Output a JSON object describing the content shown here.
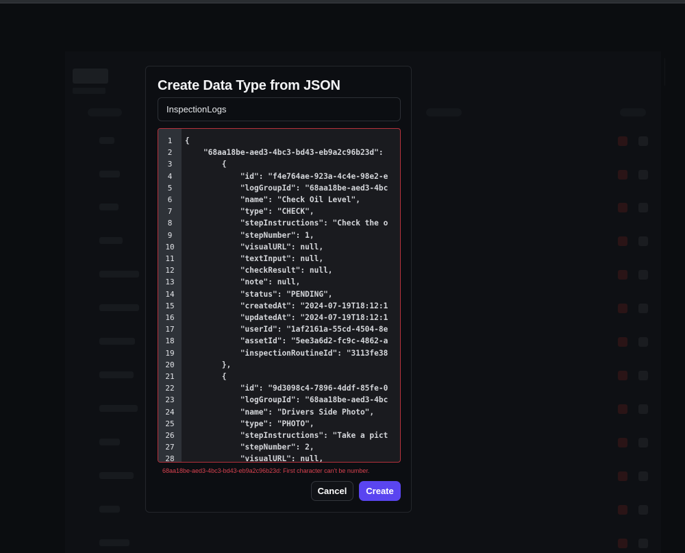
{
  "modal": {
    "title": "Create Data Type from JSON",
    "name_value": "InspectionLogs",
    "error": "68aa18be-aed3-4bc3-bd43-eb9a2c96b23d: First character can't be number.",
    "cancel_label": "Cancel",
    "create_label": "Create"
  },
  "editor": {
    "lines": [
      {
        "n": "1",
        "t": "{"
      },
      {
        "n": "2",
        "t": "    \"68aa18be-aed3-4bc3-bd43-eb9a2c96b23d\":"
      },
      {
        "n": "3",
        "t": "        {"
      },
      {
        "n": "4",
        "t": "            \"id\": \"f4e764ae-923a-4c4e-98e2-e"
      },
      {
        "n": "5",
        "t": "            \"logGroupId\": \"68aa18be-aed3-4bc"
      },
      {
        "n": "6",
        "t": "            \"name\": \"Check Oil Level\","
      },
      {
        "n": "7",
        "t": "            \"type\": \"CHECK\","
      },
      {
        "n": "8",
        "t": "            \"stepInstructions\": \"Check the o"
      },
      {
        "n": "9",
        "t": "            \"stepNumber\": 1,"
      },
      {
        "n": "10",
        "t": "            \"visualURL\": null,"
      },
      {
        "n": "11",
        "t": "            \"textInput\": null,"
      },
      {
        "n": "12",
        "t": "            \"checkResult\": null,"
      },
      {
        "n": "13",
        "t": "            \"note\": null,"
      },
      {
        "n": "14",
        "t": "            \"status\": \"PENDING\","
      },
      {
        "n": "15",
        "t": "            \"createdAt\": \"2024-07-19T18:12:1"
      },
      {
        "n": "16",
        "t": "            \"updatedAt\": \"2024-07-19T18:12:1"
      },
      {
        "n": "17",
        "t": "            \"userId\": \"1af2161a-55cd-4504-8e"
      },
      {
        "n": "18",
        "t": "            \"assetId\": \"5ee3a6d2-fc9c-4862-a"
      },
      {
        "n": "19",
        "t": "            \"inspectionRoutineId\": \"3113fe38"
      },
      {
        "n": "20",
        "t": "        },"
      },
      {
        "n": "21",
        "t": "        {"
      },
      {
        "n": "22",
        "t": "            \"id\": \"9d3098c4-7896-4ddf-85fe-0"
      },
      {
        "n": "23",
        "t": "            \"logGroupId\": \"68aa18be-aed3-4bc"
      },
      {
        "n": "24",
        "t": "            \"name\": \"Drivers Side Photo\","
      },
      {
        "n": "25",
        "t": "            \"type\": \"PHOTO\","
      },
      {
        "n": "26",
        "t": "            \"stepInstructions\": \"Take a pict"
      },
      {
        "n": "27",
        "t": "            \"stepNumber\": 2,"
      },
      {
        "n": "28",
        "t": "            \"visualURL\": null,"
      }
    ]
  },
  "colors": {
    "accent": "#5a45f0",
    "error": "#d9424f",
    "background": "#0b0d10",
    "modal": "#0c0e12"
  }
}
